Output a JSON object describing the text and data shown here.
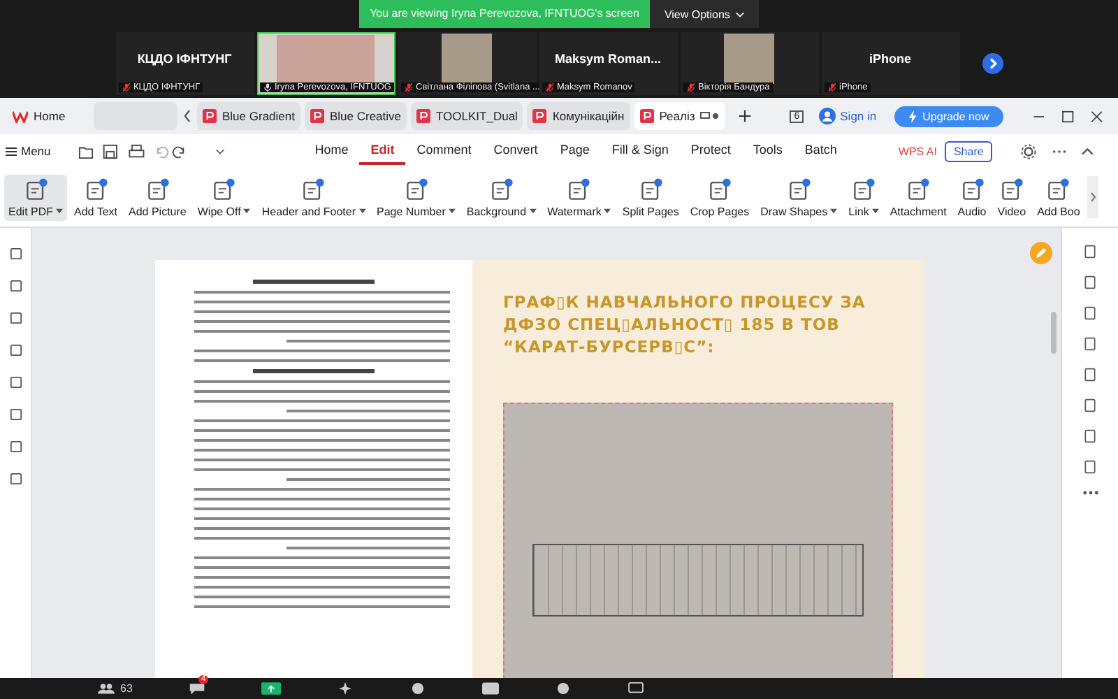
{
  "banner": {
    "text": "You are viewing Iryna Perevozova, IFNTUOG's screen",
    "button": "View Options"
  },
  "participants": [
    {
      "kind": "name",
      "display": "КЦДО ІФНТУНГ",
      "label": "КЦДО ІФНТУНГ",
      "muted": true,
      "speaking": false
    },
    {
      "kind": "video",
      "label": "Iryna Perevozova, IFNTUOG",
      "muted": false,
      "speaking": true
    },
    {
      "kind": "photo",
      "label": "Світлана Філіпова (Svitlana ...",
      "muted": true,
      "speaking": false
    },
    {
      "kind": "name",
      "display": "Maksym  Roman...",
      "label": "Maksym Romanov",
      "muted": true,
      "speaking": false
    },
    {
      "kind": "photo",
      "label": "Вікторія Бандура",
      "muted": true,
      "speaking": false
    },
    {
      "kind": "name",
      "display": "iPhone",
      "label": "iPhone",
      "muted": true,
      "speaking": false
    }
  ],
  "tabs": [
    {
      "kind": "home",
      "label": "Home",
      "selected": false
    },
    {
      "kind": "blank",
      "selected": false
    },
    {
      "kind": "doc",
      "label": "Blue Gradient",
      "selected": false
    },
    {
      "kind": "doc",
      "label": "Blue Creative",
      "selected": false
    },
    {
      "kind": "doc",
      "label": "TOOLKIT_Dual",
      "selected": false
    },
    {
      "kind": "doc",
      "label": "Комунікаційн",
      "selected": false
    },
    {
      "kind": "doc",
      "label": "Реаліз",
      "selected": true
    }
  ],
  "window_count": "6",
  "sign_in": "Sign in",
  "upgrade": "Upgrade now",
  "menu": "Menu",
  "ribbon_tabs": [
    {
      "label": "Home",
      "selected": false
    },
    {
      "label": "Edit",
      "selected": true
    },
    {
      "label": "Comment",
      "selected": false
    },
    {
      "label": "Convert",
      "selected": false
    },
    {
      "label": "Page",
      "selected": false
    },
    {
      "label": "Fill & Sign",
      "selected": false
    },
    {
      "label": "Protect",
      "selected": false
    },
    {
      "label": "Tools",
      "selected": false
    },
    {
      "label": "Batch",
      "selected": false
    }
  ],
  "wps_ai": "WPS AI",
  "share": "Share",
  "tools": [
    {
      "label": "Edit PDF",
      "dropdown": true,
      "selected": true
    },
    {
      "label": "Add Text",
      "dropdown": false,
      "selected": false
    },
    {
      "label": "Add Picture",
      "dropdown": false,
      "selected": false
    },
    {
      "label": "Wipe Off",
      "dropdown": true,
      "selected": false
    },
    {
      "label": "Header and Footer",
      "dropdown": true,
      "selected": false
    },
    {
      "label": "Page Number",
      "dropdown": true,
      "selected": false
    },
    {
      "label": "Background",
      "dropdown": true,
      "selected": false
    },
    {
      "label": "Watermark",
      "dropdown": true,
      "selected": false
    },
    {
      "label": "Split Pages",
      "dropdown": false,
      "selected": false
    },
    {
      "label": "Crop Pages",
      "dropdown": false,
      "selected": false
    },
    {
      "label": "Draw Shapes",
      "dropdown": true,
      "selected": false
    },
    {
      "label": "Link",
      "dropdown": true,
      "selected": false
    },
    {
      "label": "Attachment",
      "dropdown": false,
      "selected": false
    },
    {
      "label": "Audio",
      "dropdown": false,
      "selected": false
    },
    {
      "label": "Video",
      "dropdown": false,
      "selected": false
    },
    {
      "label": "Add Boo",
      "dropdown": false,
      "selected": false
    }
  ],
  "slide_title": "ГРАФ▯К НАВЧАЛЬНОГО ПРОЦЕСУ ЗА ДФЗО СПЕЦ▯АЛЬНОСТ▯ 185 В ТОВ “КАРАТ-БУРСЕРВ▯С”:",
  "participant_count": "63",
  "chat_badge": "4"
}
